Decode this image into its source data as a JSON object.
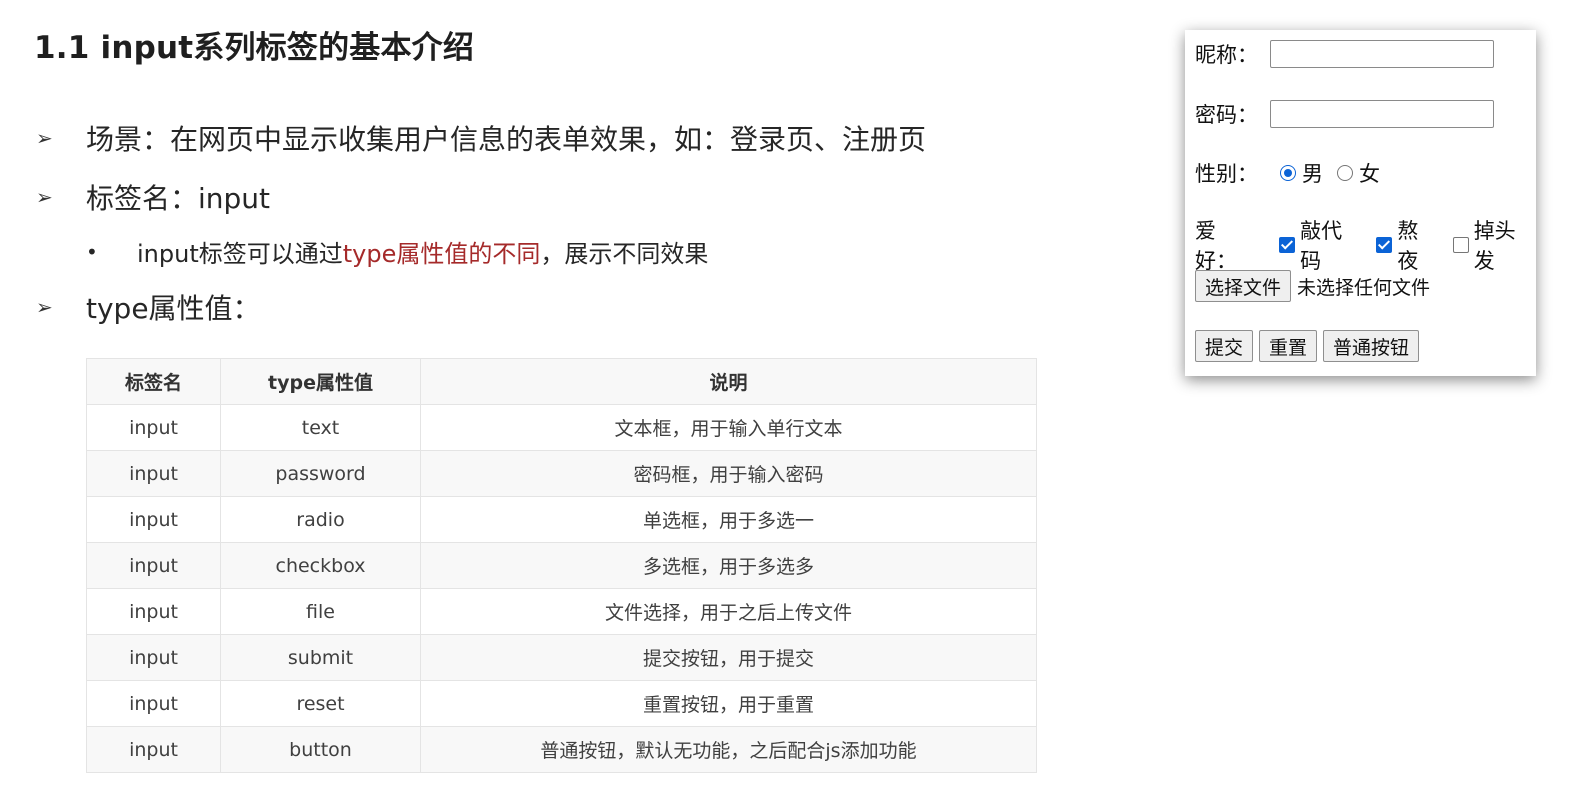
{
  "slide": {
    "title": "1.1 input系列标签的基本介绍",
    "bullets": {
      "scene": "场景：在网页中显示收集用户信息的表单效果，如：登录页、注册页",
      "tag_name": "标签名：input",
      "sub_prefix": "input标签可以通过",
      "sub_highlight": "type属性值的不同",
      "sub_suffix": "，展示不同效果",
      "type_values": "type属性值："
    },
    "bullet_glyph": "➢",
    "sub_bullet_glyph": "•",
    "highlight_color": "#a52a2a"
  },
  "table": {
    "headers": [
      "标签名",
      "type属性值",
      "说明"
    ],
    "rows": [
      [
        "input",
        "text",
        "文本框，用于输入单行文本"
      ],
      [
        "input",
        "password",
        "密码框，用于输入密码"
      ],
      [
        "input",
        "radio",
        "单选框，用于多选一"
      ],
      [
        "input",
        "checkbox",
        "多选框，用于多选多"
      ],
      [
        "input",
        "file",
        "文件选择，用于之后上传文件"
      ],
      [
        "input",
        "submit",
        "提交按钮，用于提交"
      ],
      [
        "input",
        "reset",
        "重置按钮，用于重置"
      ],
      [
        "input",
        "button",
        "普通按钮，默认无功能，之后配合js添加功能"
      ]
    ]
  },
  "form": {
    "nickname_label": "昵称：",
    "nickname_value": "",
    "password_label": "密码：",
    "password_value": "",
    "gender_label": "性别：",
    "gender_options": [
      {
        "label": "男",
        "checked": true
      },
      {
        "label": "女",
        "checked": false
      }
    ],
    "hobby_label": "爱好：",
    "hobby_options": [
      {
        "label": "敲代码",
        "checked": true
      },
      {
        "label": "熬夜",
        "checked": true
      },
      {
        "label": "掉头发",
        "checked": false
      }
    ],
    "file_button": "选择文件",
    "file_status": "未选择任何文件",
    "submit_button": "提交",
    "reset_button": "重置",
    "normal_button": "普通按钮",
    "accent_color": "#0b63d6"
  }
}
